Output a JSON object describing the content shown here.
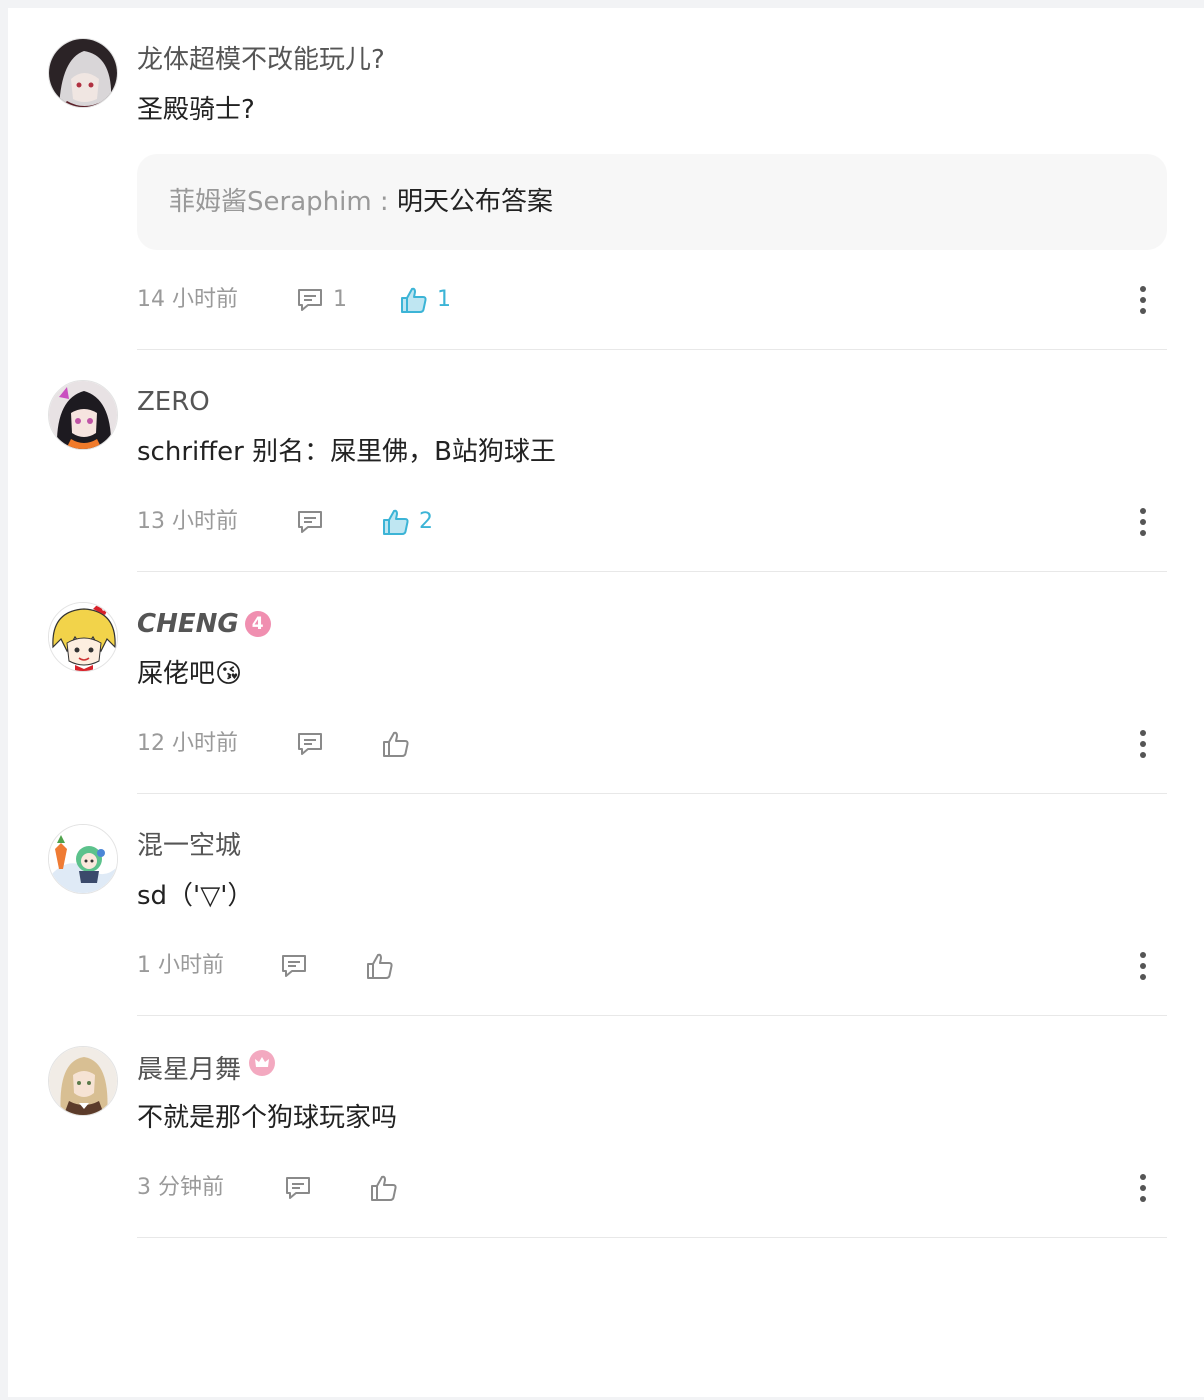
{
  "colors": {
    "accent": "#3cb4d6",
    "muted": "#9a9a9a",
    "text": "#222222",
    "badge_pink": "#f08fb0"
  },
  "comments": [
    {
      "username": "龙体超模不改能玩儿?",
      "content": "圣殿骑士?",
      "reply": {
        "author": "菲姆酱Seraphim",
        "separator": " : ",
        "text": "明天公布答案"
      },
      "time": "14 小时前",
      "reply_count": "1",
      "like_count": "1",
      "liked": true,
      "avatar_icon": "avatar-white-hair-character"
    },
    {
      "username": "ZERO",
      "content": "schriffer 别名：屎里佛，B站狗球王",
      "time": "13 小时前",
      "reply_count": "",
      "like_count": "2",
      "liked": true,
      "avatar_icon": "avatar-dark-hair-anime-girl"
    },
    {
      "username": "CHENG",
      "level_badge": "4",
      "content": "屎佬吧😘",
      "time": "12 小时前",
      "reply_count": "",
      "like_count": "",
      "liked": false,
      "avatar_icon": "avatar-blonde-chibi"
    },
    {
      "username": "混一空城",
      "content": "sd（'▽'）",
      "time": "1 小时前",
      "reply_count": "",
      "like_count": "",
      "liked": false,
      "avatar_icon": "avatar-green-chibi"
    },
    {
      "username": "晨星月舞",
      "crown_badge": "crown-icon",
      "content": "不就是那个狗球玩家吗",
      "time": "3 分钟前",
      "reply_count": "",
      "like_count": "",
      "liked": false,
      "avatar_icon": "avatar-blonde-maid"
    }
  ]
}
